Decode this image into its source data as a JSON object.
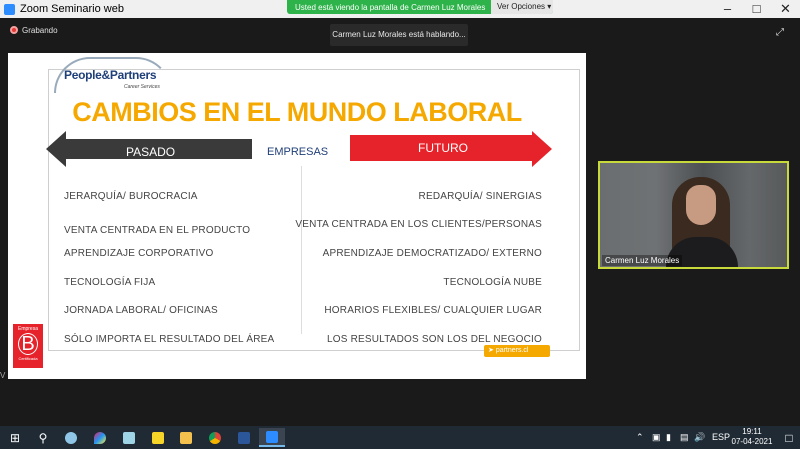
{
  "window": {
    "title": "Zoom Seminario web",
    "icon": "zoom-icon",
    "controls": [
      "minimize-icon",
      "maximize-icon",
      "close-icon"
    ]
  },
  "share_banner": {
    "message": "Usted está viendo la pantalla de Carmen Luz Morales",
    "options_label": "Ver Opciones"
  },
  "meeting": {
    "recording_label": "Grabando",
    "speaking_label": "Carmen Luz Morales está hablando..."
  },
  "slide": {
    "logo_brand": "People&Partners",
    "logo_sub": "Career Services",
    "title": "CAMBIOS EN EL MUNDO LABORAL",
    "left_arrow_label": "PASADO",
    "center_label": "EMPRESAS",
    "right_arrow_label": "FUTURO",
    "colors": {
      "title": "#f5a800",
      "left_arrow": "#3a3a3a",
      "right_arrow": "#e6232b",
      "empresas": "#1f3f78"
    },
    "past": [
      "JERARQUÍA/ BUROCRACIA",
      "VENTA CENTRADA EN EL PRODUCTO",
      "APRENDIZAJE CORPORATIVO",
      "TECNOLOGÍA FIJA",
      "JORNADA LABORAL/ OFICINAS",
      "SÓLO IMPORTA EL RESULTADO DEL ÁREA"
    ],
    "future": [
      "REDARQUÍA/ SINERGIAS",
      "VENTA CENTRADA EN LOS CLIENTES/PERSONAS",
      "APRENDIZAJE DEMOCRATIZADO/ EXTERNO",
      "TECNOLOGÍA NUBE",
      "HORARIOS FLEXIBLES/ CUALQUIER LUGAR",
      "LOS RESULTADOS SON LOS DEL NEGOCIO"
    ],
    "bcorp": {
      "top": "Empresa",
      "letter": "B",
      "bottom": "Certificada"
    },
    "site": "partners.cl"
  },
  "video": {
    "participant_name": "Carmen Luz Morales"
  },
  "edge_char": "V",
  "taskbar": {
    "apps": [
      "windows-start-icon",
      "search-icon",
      "paint-icon",
      "color-drop-icon",
      "notes-icon",
      "sticky-notes-icon",
      "file-explorer-icon",
      "chrome-icon",
      "word-icon",
      "zoom-icon"
    ],
    "language": "ESP",
    "time": "19:11",
    "date": "07-04-2021"
  }
}
